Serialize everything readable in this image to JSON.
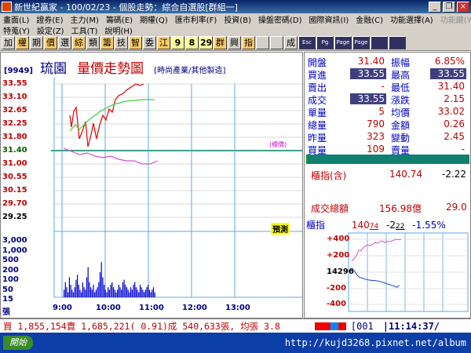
{
  "window": {
    "title": "新世紀贏家 - 100/02/23 - 個股走勢：綜合自選股[群組一]"
  },
  "menu_row1": [
    "畫面(L)",
    "證券(E)",
    "主力(M)",
    "籌碼(E)",
    "期權(Q)",
    "匯市利率(F)",
    "投資(B)",
    "操盤密碼(D)",
    "國際資訊(I)",
    "金融(C)",
    "功能選擇(A)",
    "功能鍵(Y)"
  ],
  "menu_row2": [
    "特蒐(Y)",
    "設定(Z)",
    "工具(T)",
    "說明(H)"
  ],
  "toolbar": [
    "加",
    "權",
    "期",
    "價",
    "選",
    "綜",
    "類",
    "籌",
    "技",
    "智",
    "委",
    "江",
    "9",
    "8",
    "29",
    "群",
    "興",
    "指",
    "",
    "",
    "成",
    "Esc",
    "Pg",
    "Page",
    "Page",
    "",
    ""
  ],
  "stock": {
    "code": "[9949]",
    "name": "琉園",
    "chart_title": "量價走勢圖",
    "category": "[時尚產業/其他製造]"
  },
  "price_axis": [
    "33.55",
    "33.10",
    "32.65",
    "32.25",
    "31.80",
    "31.40",
    "31.00",
    "30.55",
    "30.15",
    "29.70",
    "29.25"
  ],
  "volume_axis": [
    "3,000",
    "1,000",
    "500",
    "200",
    "100",
    "50",
    "15",
    "張"
  ],
  "time_axis": [
    "9:00",
    "10:00",
    "11:00",
    "12:00",
    "13:00"
  ],
  "ref_label": "(標價)",
  "yellow_tag": "預測",
  "quote": {
    "rows": [
      {
        "l1": "開盤",
        "v1": "31.40",
        "l2": "振幅",
        "v2": "6.85%"
      },
      {
        "l1": "買進",
        "v1": "33.55",
        "l2": "最高",
        "v2": "33.55"
      },
      {
        "l1": "賣出",
        "v1": "-",
        "l2": "最低",
        "v2": "31.40"
      },
      {
        "l1": "成交",
        "v1": "33.55",
        "l2": "漲跌",
        "v2": "2.15"
      },
      {
        "l1": "單量",
        "v1": "5",
        "l2": "均價",
        "v2": "33.02"
      },
      {
        "l1": "總量",
        "v1": "790",
        "l2": "金額",
        "v2": "0.26"
      },
      {
        "l1": "昨量",
        "v1": "323",
        "l2": "變動",
        "v2": "2.45"
      },
      {
        "l1": "買量",
        "v1": "109",
        "l2": "賣量",
        "v2": "-"
      }
    ],
    "index_label": "櫃指(含)",
    "index_value": "140.74",
    "index_change": "-2.22",
    "turnover_label": "成交總額",
    "turnover_value": "156.98億",
    "turnover_extra": "29.0"
  },
  "mini": {
    "label": "櫃指",
    "value": "140",
    "value_small": "74",
    "change": "-2",
    "change_small": "22",
    "pct": "-1.55%",
    "axis": [
      "+400",
      "+200",
      "14296",
      "-200",
      "-400"
    ],
    "axis_mid_big": "142",
    "axis_mid_small": "96"
  },
  "status": {
    "text": "買 1,855,154賣 1,685,221( 0.91)成 540,633張, 均張 3.8",
    "page": "[001",
    "time": "|11:14:37/"
  },
  "taskbar": {
    "start": "開始",
    "watermark": "http://kujd3268.pixnet.net/album"
  },
  "chart_data": {
    "type": "line",
    "x_range": [
      "9:00",
      "13:30"
    ],
    "ylim": [
      29.25,
      33.55
    ],
    "reference_price": 31.4,
    "series": [],
    "volume_bars": [
      3,
      6,
      4,
      2,
      8,
      5,
      3,
      2,
      4,
      7,
      9,
      5,
      3,
      2,
      6,
      4,
      3,
      8,
      12,
      6,
      4,
      3,
      5,
      2,
      3,
      4,
      6,
      10,
      14,
      8,
      5,
      3,
      2,
      4,
      3,
      5,
      6,
      4,
      3,
      2,
      3,
      5,
      4,
      3,
      6,
      7,
      5,
      4,
      3,
      2,
      4,
      3,
      5,
      6,
      4,
      3,
      2,
      5,
      4,
      3,
      2,
      3,
      4,
      5,
      3,
      2,
      3,
      4,
      2
    ]
  },
  "mini_chart": {
    "index_series_label": "",
    "line_up": [
      140,
      160,
      200,
      270,
      260,
      300,
      320,
      330,
      320,
      340,
      360,
      350,
      370,
      380,
      360,
      375,
      370,
      380,
      390,
      400,
      395,
      400
    ],
    "line_down": [
      40,
      20,
      -30,
      -60,
      -70,
      -80,
      -90,
      -95,
      -100,
      -100,
      -105,
      -110,
      -120,
      -130,
      -140,
      -150,
      -160,
      -170,
      -185,
      -160
    ]
  }
}
